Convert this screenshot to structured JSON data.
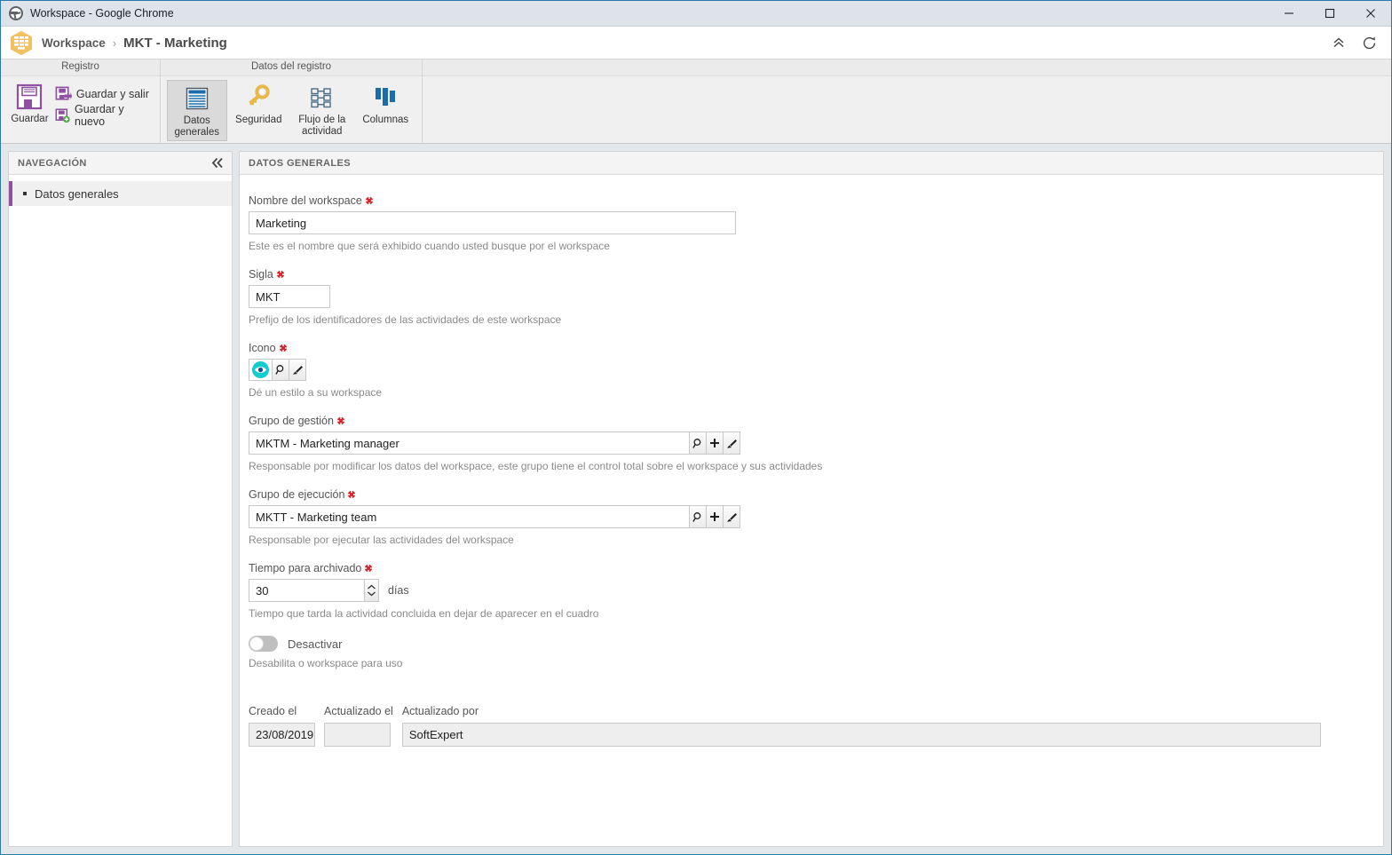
{
  "window": {
    "title": "Workspace - Google Chrome",
    "icon": "chrome-window-icon",
    "minimize_label": "Minimizar",
    "maximize_label": "Maximizar",
    "close_label": "Cerrar"
  },
  "header": {
    "logo": "workspace-hexagon-icon",
    "breadcrumb_root": "Workspace",
    "breadcrumb_separator": "›",
    "breadcrumb_leaf": "MKT - Marketing",
    "collapse_icon": "chevron-double-up-icon",
    "refresh_icon": "refresh-icon"
  },
  "ribbon": {
    "groups": [
      {
        "title": "Registro",
        "buttons": [
          {
            "label": "Guardar",
            "icon": "floppy-disk-icon"
          },
          {
            "label": "Guardar y salir",
            "icon": "floppy-disk-exit-icon"
          },
          {
            "label": "Guardar y nuevo",
            "icon": "floppy-disk-new-icon"
          }
        ]
      },
      {
        "title": "Datos del registro",
        "buttons": [
          {
            "label": "Datos generales",
            "icon": "document-lines-icon",
            "active": true
          },
          {
            "label": "Seguridad",
            "icon": "key-icon",
            "active": false
          },
          {
            "label": "Flujo de la actividad",
            "icon": "flowchart-icon",
            "active": false
          },
          {
            "label": "Columnas",
            "icon": "columns-icon",
            "active": false
          }
        ]
      }
    ]
  },
  "navigation": {
    "title": "NAVEGACIÓN",
    "collapse_icon": "chevron-double-left-icon",
    "items": [
      {
        "label": "Datos generales",
        "selected": true
      }
    ]
  },
  "content": {
    "section_title": "DATOS GENERALES",
    "fields": {
      "name": {
        "label": "Nombre del workspace",
        "required": true,
        "value": "Marketing",
        "hint": "Este es el nombre que será exhibido cuando usted busque por el workspace"
      },
      "sigla": {
        "label": "Sigla",
        "required": true,
        "value": "MKT",
        "hint": "Prefijo de los identificadores de las actividades de este workspace"
      },
      "icono": {
        "label": "Icono",
        "required": true,
        "selected_icon": "eye-icon",
        "selected_color": "#12ccd0",
        "search_icon": "magnifier-icon",
        "brush_icon": "paintbrush-icon",
        "hint": "Dé un estilo a su workspace"
      },
      "grupo_gestion": {
        "label": "Grupo de gestión",
        "required": true,
        "value": "MKTM - Marketing manager",
        "buttons": [
          "magnifier-icon",
          "plus-icon",
          "paintbrush-icon"
        ],
        "hint": "Responsable por modificar los datos del workspace, este grupo tiene el control total sobre el workspace y sus actividades"
      },
      "grupo_ejecucion": {
        "label": "Grupo de ejecución",
        "required": true,
        "value": "MKTT - Marketing team",
        "buttons": [
          "magnifier-icon",
          "plus-icon",
          "paintbrush-icon"
        ],
        "hint": "Responsable por ejecutar las actividades del workspace"
      },
      "tiempo_archivado": {
        "label": "Tiempo para archivado",
        "required": true,
        "value": "30",
        "unit": "días",
        "hint": "Tiempo que tarda la actividad concluida en dejar de aparecer en el cuadro"
      },
      "desactivar": {
        "label": "Desactivar",
        "state": "off",
        "hint": "Desabilita o workspace para uso"
      }
    },
    "audit": {
      "created_label": "Creado el",
      "created_value": "23/08/2019",
      "updated_label": "Actualizado el",
      "updated_value": "",
      "updated_by_label": "Actualizado por",
      "updated_by_value": "SoftExpert"
    }
  },
  "colors": {
    "accent_purple": "#8f50a0",
    "logo_yellow": "#f0c060",
    "required_red": "#d3262a",
    "tab_blue": "#1b6ca8",
    "key_gold": "#e8b84b",
    "icon_cyan": "#12ccd0",
    "window_border": "#2a7ab0"
  }
}
